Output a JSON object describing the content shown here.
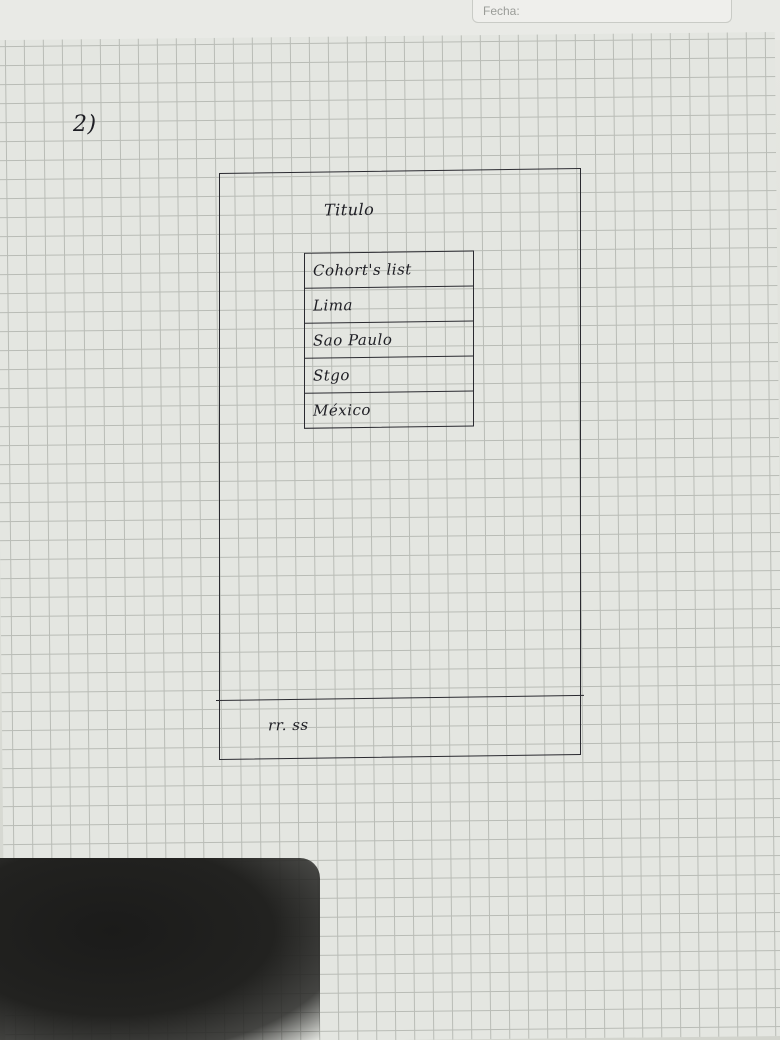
{
  "header": {
    "date_label": "Fecha:"
  },
  "sketch": {
    "exercise_number": "2)",
    "screen_title": "Titulo",
    "table": {
      "header": "Cohort's list",
      "rows": [
        "Lima",
        "Sao Paulo",
        "Stgo",
        "México"
      ]
    },
    "footer_text": "rr. ss"
  }
}
